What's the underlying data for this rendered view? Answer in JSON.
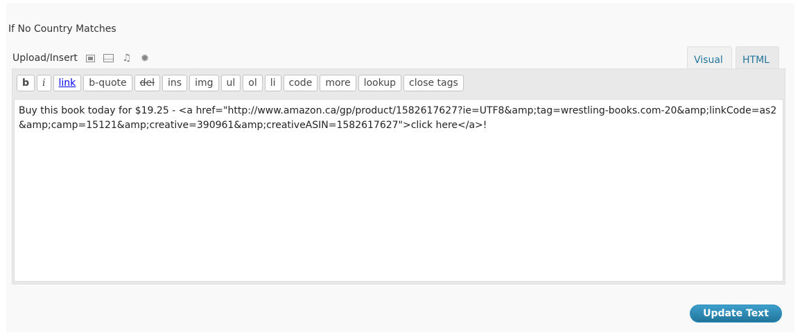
{
  "section": {
    "title": "If No Country Matches"
  },
  "media": {
    "label": "Upload/Insert",
    "icons": [
      "add-image-icon",
      "add-video-icon",
      "add-audio-icon",
      "add-media-icon"
    ],
    "audio_glyph": "♫",
    "media_glyph": "✹"
  },
  "tabs": {
    "visual": "Visual",
    "html": "HTML",
    "active": "HTML"
  },
  "toolbar": {
    "buttons": [
      "b",
      "i",
      "link",
      "b-quote",
      "del",
      "ins",
      "img",
      "ul",
      "ol",
      "li",
      "code",
      "more",
      "lookup",
      "close tags"
    ]
  },
  "editor": {
    "content": "Buy this book today for $19.25 - <a href=\"http://www.amazon.ca/gp/product/1582617627?ie=UTF8&amp;tag=wrestling-books.com-20&amp;linkCode=as2&amp;camp=15121&amp;creative=390961&amp;creativeASIN=1582617627\">click here</a>!"
  },
  "actions": {
    "update_label": "Update Text"
  },
  "colors": {
    "accent": "#21759b",
    "panel_bg": "#f9f9f9",
    "toolbar_bg": "#e9e9e9"
  }
}
